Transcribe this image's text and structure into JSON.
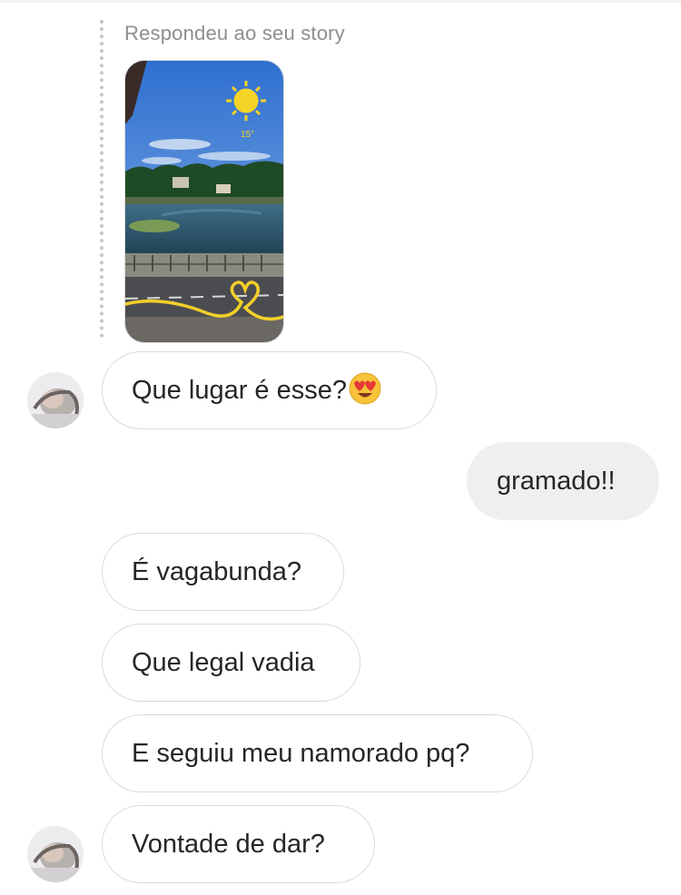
{
  "thread": {
    "reply_header": "Respondeu ao seu story",
    "story": {
      "temperature": "15°",
      "weather_icon": "sun-icon"
    },
    "messages": [
      {
        "sender": "them",
        "text": "Que lugar é esse?",
        "emoji": "heart-eyes-emoji"
      },
      {
        "sender": "me",
        "text": "gramado!!"
      },
      {
        "sender": "them",
        "text": "É vagabunda?"
      },
      {
        "sender": "them",
        "text": "Que legal vadia"
      },
      {
        "sender": "them",
        "text": "E seguiu meu namorado pq?"
      },
      {
        "sender": "them",
        "text": "Vontade de dar?"
      }
    ]
  },
  "colors": {
    "incoming_bubble_border": "#dbdbdb",
    "outgoing_bubble_bg": "#efefef",
    "muted_text": "#8e8e8e",
    "text": "#262626"
  }
}
